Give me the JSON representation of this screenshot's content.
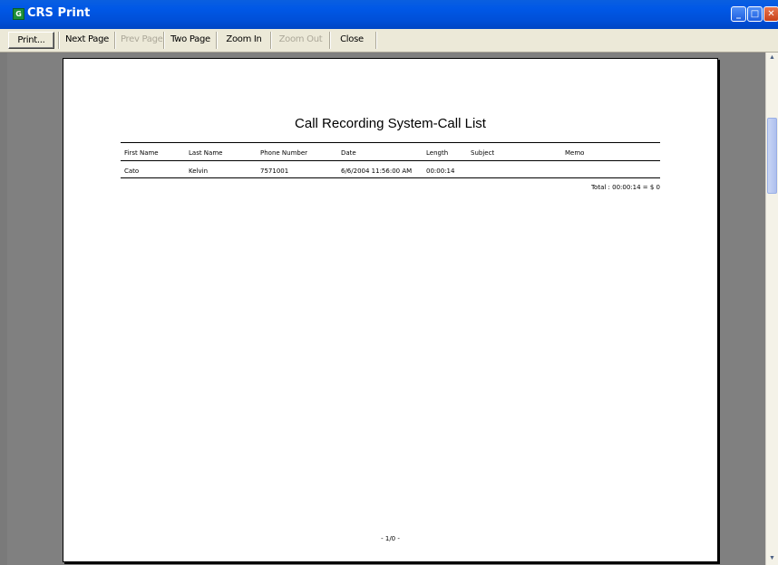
{
  "window": {
    "title": "CRS Print",
    "app_icon_letter": "G",
    "minimize_glyph": "_",
    "maximize_glyph": "□",
    "close_glyph": "✕"
  },
  "toolbar": {
    "print_label": "Print...",
    "next_page_label": "Next Page",
    "prev_page_label": "Prev Page",
    "two_page_label": "Two Page",
    "zoom_in_label": "Zoom In",
    "zoom_out_label": "Zoom Out",
    "close_label": "Close"
  },
  "report": {
    "title": "Call Recording System-Call List",
    "columns": [
      "First Name",
      "Last Name",
      "Phone Number",
      "Date",
      "Length",
      "Subject",
      "Memo"
    ],
    "rows": [
      {
        "first_name": "Cato",
        "last_name": "Kelvin",
        "phone": "7571001",
        "date": "6/6/2004 11:56:00 AM",
        "length": "00:00:14",
        "subject": "",
        "memo": ""
      }
    ],
    "total": "Total : 00:00:14 = $ 0",
    "page_number": "- 1/0 -"
  },
  "colors": {
    "titlebar": "#0058e6",
    "toolbar": "#ece9d8",
    "preview_background": "#808080",
    "page": "#ffffff"
  },
  "icons": {
    "scroll_up": "scroll-up-arrow-icon",
    "scroll_down": "scroll-down-arrow-icon"
  }
}
